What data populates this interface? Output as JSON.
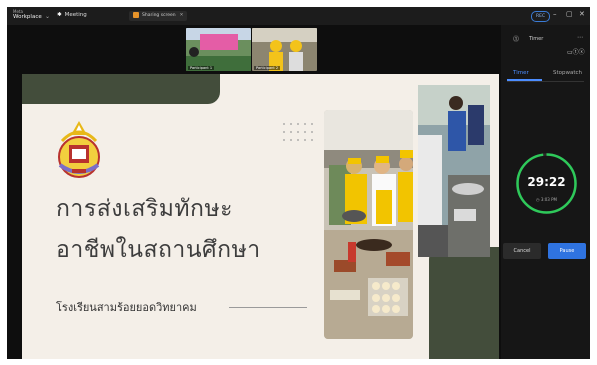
{
  "app": {
    "brand": "Workplace",
    "brand_small": "Meta",
    "meeting_label": "Meeting"
  },
  "share": {
    "label": "Sharing screen"
  },
  "status_pill": "REC",
  "window": {
    "minimize": "–",
    "maximize": "▢",
    "close": "✕"
  },
  "thumbnails": [
    {
      "label": "Participant 1"
    },
    {
      "label": "Participant 2"
    }
  ],
  "slide": {
    "title_line1": "การส่งเสริมทักษะ",
    "title_line2": "อาชีพในสถานศึกษา",
    "school": "โรงเรียนสามร้อยยอดวิทยาคม"
  },
  "panel": {
    "title": "Timer",
    "tabs": [
      "Timer",
      "Stopwatch"
    ],
    "time": "29:22",
    "end_time": "3:03 PM",
    "progress": 0.98,
    "cancel": "Cancel",
    "pause": "Pause"
  },
  "colors": {
    "accent": "#2f73e0",
    "ring": "#2ec95a",
    "slide_band": "#434d3b"
  }
}
